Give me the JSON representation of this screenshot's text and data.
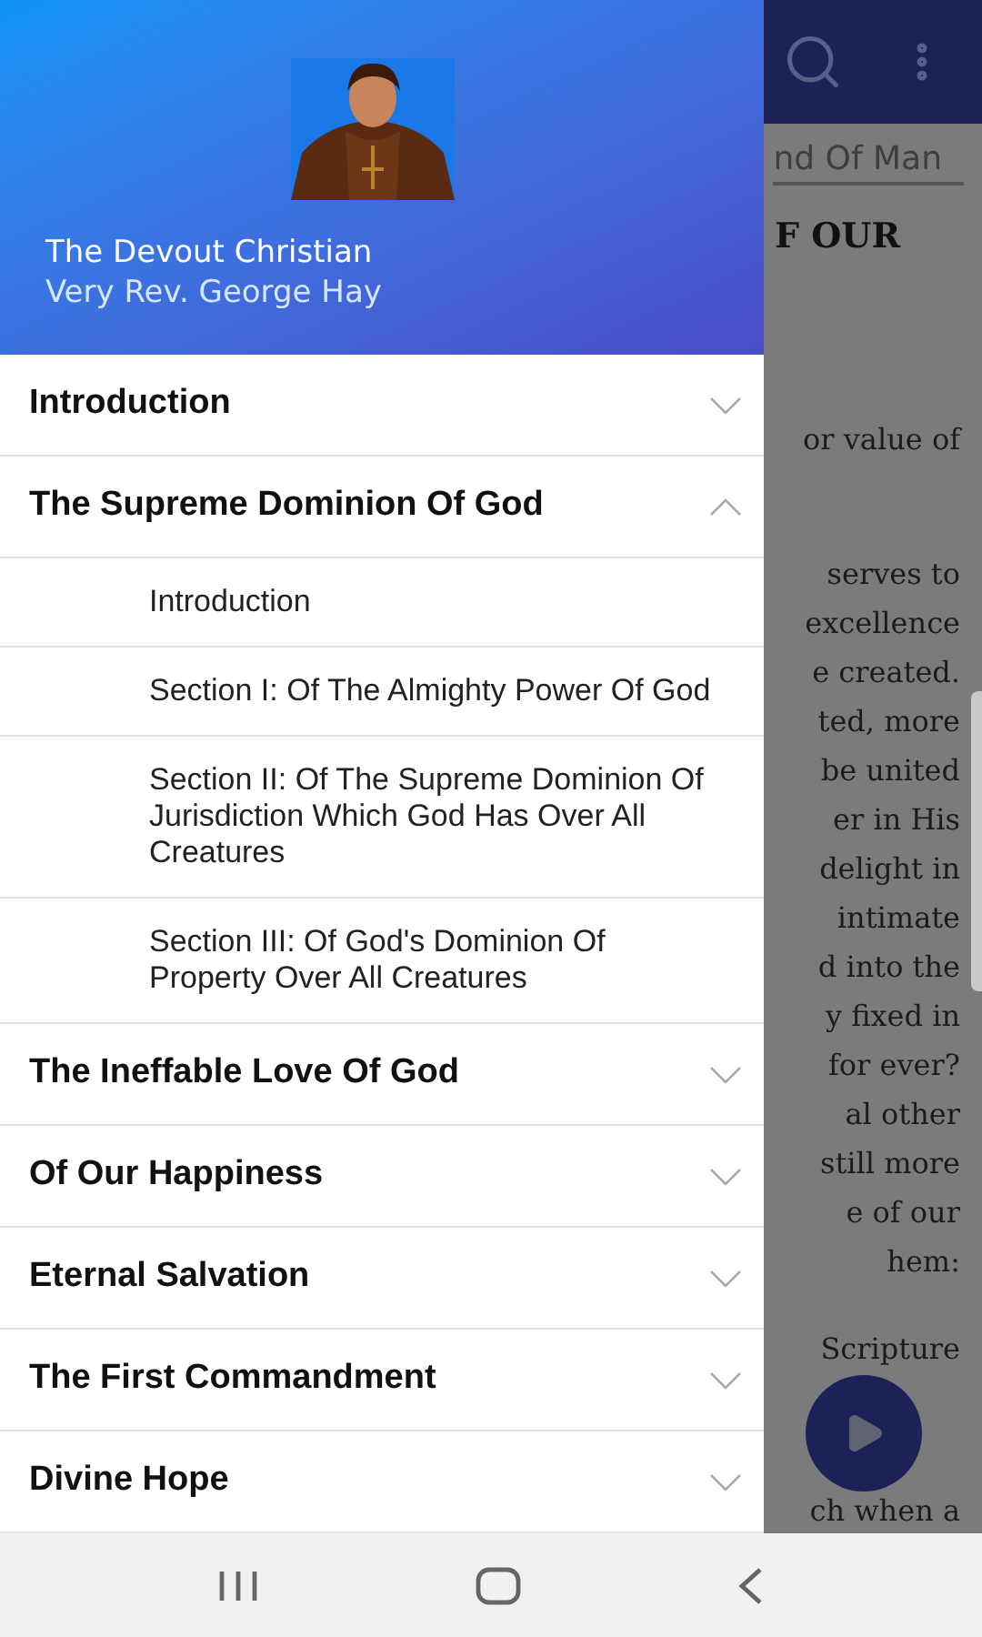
{
  "drawer": {
    "title": "The Devout Christian",
    "author": "Very Rev. George Hay",
    "chapters": [
      {
        "label": "Introduction",
        "expanded": false
      },
      {
        "label": "The Supreme Dominion Of God",
        "expanded": true,
        "children": [
          {
            "label": "Introduction"
          },
          {
            "label": "Section I: Of The Almighty Power Of God"
          },
          {
            "label": "Section II: Of The Supreme Dominion Of Jurisdiction Which God Has Over All Creatures"
          },
          {
            "label": "Section III: Of God's Dominion Of Property Over All Creatures"
          }
        ]
      },
      {
        "label": "The Ineffable Love Of God",
        "expanded": false
      },
      {
        "label": "Of Our Happiness",
        "expanded": false
      },
      {
        "label": "Eternal Salvation",
        "expanded": false
      },
      {
        "label": "The First Commandment",
        "expanded": false
      },
      {
        "label": "Divine Hope",
        "expanded": false
      }
    ]
  },
  "reader": {
    "tab": "nd Of Man",
    "heading": "F OUR",
    "lines": [
      {
        "kind": "text",
        "text": "or value of"
      },
      {
        "kind": "blank"
      },
      {
        "kind": "text",
        "text": "serves to"
      },
      {
        "kind": "text",
        "text": "excellence"
      },
      {
        "kind": "text",
        "text": "e created."
      },
      {
        "kind": "text",
        "text": "ted, more"
      },
      {
        "kind": "text",
        "text": "be united"
      },
      {
        "kind": "text",
        "text": "er in His"
      },
      {
        "kind": "text",
        "text": "delight in"
      },
      {
        "kind": "text",
        "text": "intimate"
      },
      {
        "kind": "text",
        "text": "d into the"
      },
      {
        "kind": "text",
        "text": "y fixed in"
      },
      {
        "kind": "text",
        "text": "for ever?"
      },
      {
        "kind": "text",
        "text": "al other"
      },
      {
        "kind": "text",
        "text": "still more"
      },
      {
        "kind": "text",
        "text": "e of our"
      },
      {
        "kind": "text",
        "text": "hem:"
      },
      {
        "kind": "blank"
      },
      {
        "kind": "text",
        "text": "Scripture"
      },
      {
        "kind": "covered"
      },
      {
        "kind": "covered"
      },
      {
        "kind": "text",
        "text": "ch when a"
      }
    ]
  }
}
